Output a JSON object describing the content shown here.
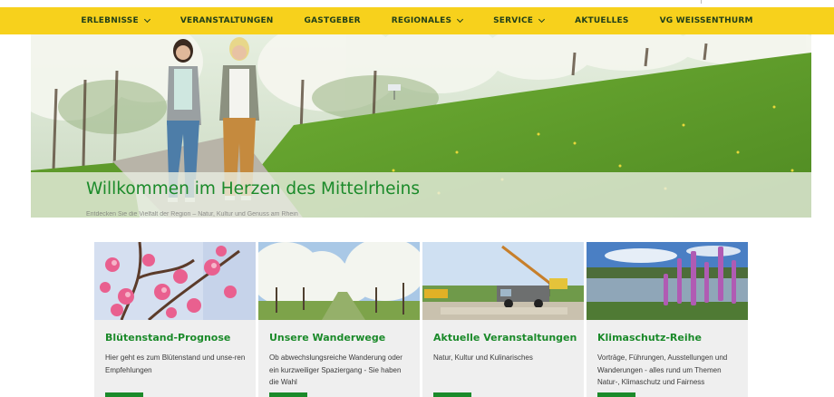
{
  "nav": {
    "items": [
      {
        "label": "ERLEBNISSE",
        "dropdown": true
      },
      {
        "label": "VERANSTALTUNGEN",
        "dropdown": false
      },
      {
        "label": "GASTGEBER",
        "dropdown": false
      },
      {
        "label": "REGIONALES",
        "dropdown": true
      },
      {
        "label": "SERVICE",
        "dropdown": true
      },
      {
        "label": "AKTUELLES",
        "dropdown": false
      },
      {
        "label": "VG WEISSENTHURM",
        "dropdown": false
      }
    ]
  },
  "hero": {
    "title": "Willkommen im Herzen des Mittelrheins",
    "subtitle": "Entdecken Sie die Vielfalt der Region – Natur, Kultur und Genuss am Rhein"
  },
  "cards": [
    {
      "title": "Blütenstand-Prognose",
      "text": "Hier geht es zum Blütenstand und unse-ren Empfehlungen",
      "image": "peach-blossom-photo"
    },
    {
      "title": "Unsere Wanderwege",
      "text": "Ob abwechslungsreiche Wanderung oder ein kurzweiliger Spaziergang - Sie haben die Wahl",
      "image": "orchard-photo"
    },
    {
      "title": "Aktuelle Veranstaltungen",
      "text": "Natur, Kultur und Kulinarisches",
      "image": "crane-truck-photo"
    },
    {
      "title": "Klimaschutz-Reihe",
      "text": "Vorträge, Führungen, Ausstellungen und Wanderungen - alles rund um Themen Natur-, Klimaschutz und Fairness",
      "image": "lake-flowers-photo"
    }
  ],
  "colors": {
    "nav_bg": "#f7d11c",
    "nav_text": "#1f3e1a",
    "accent_green": "#1b8a2a",
    "card_bg": "#efefef"
  }
}
